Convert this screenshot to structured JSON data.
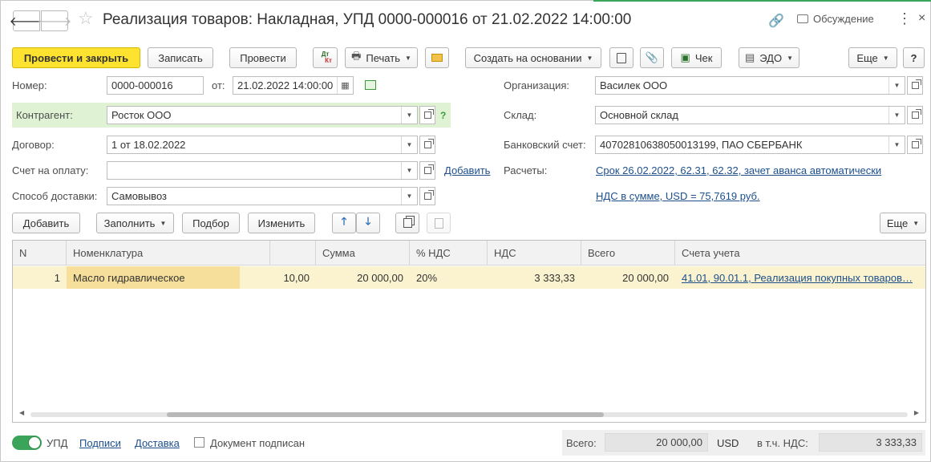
{
  "window": {
    "title": "Реализация товаров: Накладная, УПД 0000-000016 от 21.02.2022 14:00:00",
    "discussion_label": "Обсуждение",
    "back_glyph": "🡐",
    "forward_glyph": "🡒",
    "star_glyph": "☆",
    "link_glyph": "🔗",
    "more_glyph": "⋮",
    "close_glyph": "×"
  },
  "toolbar": {
    "post_and_close": "Провести и закрыть",
    "save": "Записать",
    "post": "Провести",
    "dtkt_top": "Дт",
    "dtkt_bottom": "Кт",
    "print": "Печать",
    "create_based_on": "Создать на основании",
    "receipt": "Чек",
    "edo": "ЭДО",
    "more": "Еще",
    "help": "?"
  },
  "form": {
    "number_label": "Номер:",
    "number_value": "0000-000016",
    "date_label": "от:",
    "date_value": "21.02.2022 14:00:00",
    "counterparty_label": "Контрагент:",
    "counterparty_value": "Росток ООО",
    "contract_label": "Договор:",
    "contract_value": "1 от 18.02.2022",
    "invoice_label": "Счет на оплату:",
    "invoice_value": "",
    "add_link": "Добавить",
    "delivery_label": "Способ доставки:",
    "delivery_value": "Самовывоз",
    "org_label": "Организация:",
    "org_value": "Василек ООО",
    "warehouse_label": "Склад:",
    "warehouse_value": "Основной склад",
    "bank_label": "Банковский счет:",
    "bank_value": "40702810638050013199, ПАО СБЕРБАНК",
    "settlements_label": "Расчеты:",
    "settlements_link": "Срок 26.02.2022, 62.31, 62.32, зачет аванса автоматически",
    "vat_link": "НДС в сумме, USD = 75,7619 руб.",
    "help_mark": "?"
  },
  "table_toolbar": {
    "add": "Добавить",
    "fill": "Заполнить",
    "pick": "Подбор",
    "change": "Изменить",
    "up_glyph": "🡑",
    "down_glyph": "🡓",
    "more": "Еще"
  },
  "table": {
    "columns": [
      "N",
      "Номенклатура",
      "",
      "Сумма",
      "% НДС",
      "НДС",
      "Всего",
      "Счета учета"
    ],
    "rows": [
      {
        "n": "1",
        "item": "Масло гидравлическое",
        "qty": "10,00",
        "sum": "20 000,00",
        "vat_rate": "20%",
        "vat": "3 333,33",
        "total": "20 000,00",
        "accounts": "41.01, 90.01.1, Реализация покупных товаров…"
      }
    ]
  },
  "footer": {
    "upd_label": "УПД",
    "signatures_link": "Подписи",
    "delivery_link": "Доставка",
    "signed_label": "Документ подписан",
    "total_label": "Всего:",
    "total_value": "20 000,00",
    "currency": "USD",
    "vat_label": "в т.ч. НДС:",
    "vat_value": "3 333,33"
  },
  "colors": {
    "primary_button": "#fde22f",
    "counterparty_highlight": "#dff3d4",
    "selected_row": "#fbf3cf",
    "link": "#1c4f8c",
    "toggle_on": "#3aa55a"
  }
}
